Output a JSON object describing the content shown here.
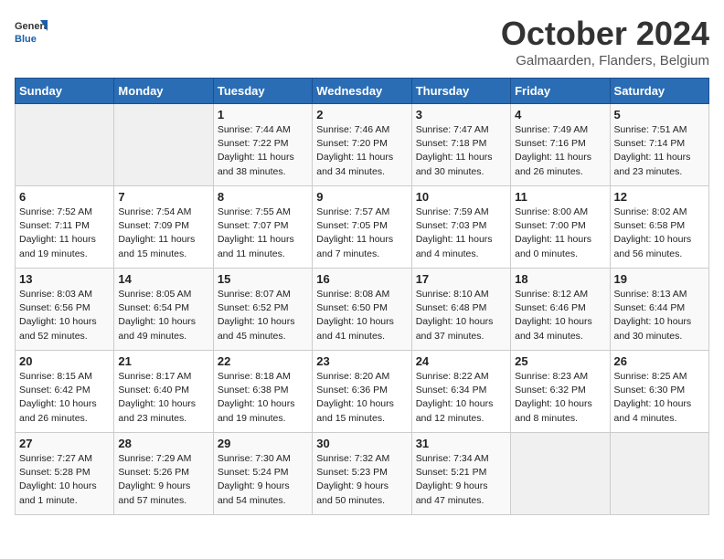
{
  "header": {
    "logo_general": "General",
    "logo_blue": "Blue",
    "title": "October 2024",
    "subtitle": "Galmaarden, Flanders, Belgium"
  },
  "days_of_week": [
    "Sunday",
    "Monday",
    "Tuesday",
    "Wednesday",
    "Thursday",
    "Friday",
    "Saturday"
  ],
  "weeks": [
    [
      {
        "day": "",
        "info": ""
      },
      {
        "day": "",
        "info": ""
      },
      {
        "day": "1",
        "info": "Sunrise: 7:44 AM\nSunset: 7:22 PM\nDaylight: 11 hours\nand 38 minutes."
      },
      {
        "day": "2",
        "info": "Sunrise: 7:46 AM\nSunset: 7:20 PM\nDaylight: 11 hours\nand 34 minutes."
      },
      {
        "day": "3",
        "info": "Sunrise: 7:47 AM\nSunset: 7:18 PM\nDaylight: 11 hours\nand 30 minutes."
      },
      {
        "day": "4",
        "info": "Sunrise: 7:49 AM\nSunset: 7:16 PM\nDaylight: 11 hours\nand 26 minutes."
      },
      {
        "day": "5",
        "info": "Sunrise: 7:51 AM\nSunset: 7:14 PM\nDaylight: 11 hours\nand 23 minutes."
      }
    ],
    [
      {
        "day": "6",
        "info": "Sunrise: 7:52 AM\nSunset: 7:11 PM\nDaylight: 11 hours\nand 19 minutes."
      },
      {
        "day": "7",
        "info": "Sunrise: 7:54 AM\nSunset: 7:09 PM\nDaylight: 11 hours\nand 15 minutes."
      },
      {
        "day": "8",
        "info": "Sunrise: 7:55 AM\nSunset: 7:07 PM\nDaylight: 11 hours\nand 11 minutes."
      },
      {
        "day": "9",
        "info": "Sunrise: 7:57 AM\nSunset: 7:05 PM\nDaylight: 11 hours\nand 7 minutes."
      },
      {
        "day": "10",
        "info": "Sunrise: 7:59 AM\nSunset: 7:03 PM\nDaylight: 11 hours\nand 4 minutes."
      },
      {
        "day": "11",
        "info": "Sunrise: 8:00 AM\nSunset: 7:00 PM\nDaylight: 11 hours\nand 0 minutes."
      },
      {
        "day": "12",
        "info": "Sunrise: 8:02 AM\nSunset: 6:58 PM\nDaylight: 10 hours\nand 56 minutes."
      }
    ],
    [
      {
        "day": "13",
        "info": "Sunrise: 8:03 AM\nSunset: 6:56 PM\nDaylight: 10 hours\nand 52 minutes."
      },
      {
        "day": "14",
        "info": "Sunrise: 8:05 AM\nSunset: 6:54 PM\nDaylight: 10 hours\nand 49 minutes."
      },
      {
        "day": "15",
        "info": "Sunrise: 8:07 AM\nSunset: 6:52 PM\nDaylight: 10 hours\nand 45 minutes."
      },
      {
        "day": "16",
        "info": "Sunrise: 8:08 AM\nSunset: 6:50 PM\nDaylight: 10 hours\nand 41 minutes."
      },
      {
        "day": "17",
        "info": "Sunrise: 8:10 AM\nSunset: 6:48 PM\nDaylight: 10 hours\nand 37 minutes."
      },
      {
        "day": "18",
        "info": "Sunrise: 8:12 AM\nSunset: 6:46 PM\nDaylight: 10 hours\nand 34 minutes."
      },
      {
        "day": "19",
        "info": "Sunrise: 8:13 AM\nSunset: 6:44 PM\nDaylight: 10 hours\nand 30 minutes."
      }
    ],
    [
      {
        "day": "20",
        "info": "Sunrise: 8:15 AM\nSunset: 6:42 PM\nDaylight: 10 hours\nand 26 minutes."
      },
      {
        "day": "21",
        "info": "Sunrise: 8:17 AM\nSunset: 6:40 PM\nDaylight: 10 hours\nand 23 minutes."
      },
      {
        "day": "22",
        "info": "Sunrise: 8:18 AM\nSunset: 6:38 PM\nDaylight: 10 hours\nand 19 minutes."
      },
      {
        "day": "23",
        "info": "Sunrise: 8:20 AM\nSunset: 6:36 PM\nDaylight: 10 hours\nand 15 minutes."
      },
      {
        "day": "24",
        "info": "Sunrise: 8:22 AM\nSunset: 6:34 PM\nDaylight: 10 hours\nand 12 minutes."
      },
      {
        "day": "25",
        "info": "Sunrise: 8:23 AM\nSunset: 6:32 PM\nDaylight: 10 hours\nand 8 minutes."
      },
      {
        "day": "26",
        "info": "Sunrise: 8:25 AM\nSunset: 6:30 PM\nDaylight: 10 hours\nand 4 minutes."
      }
    ],
    [
      {
        "day": "27",
        "info": "Sunrise: 7:27 AM\nSunset: 5:28 PM\nDaylight: 10 hours\nand 1 minute."
      },
      {
        "day": "28",
        "info": "Sunrise: 7:29 AM\nSunset: 5:26 PM\nDaylight: 9 hours\nand 57 minutes."
      },
      {
        "day": "29",
        "info": "Sunrise: 7:30 AM\nSunset: 5:24 PM\nDaylight: 9 hours\nand 54 minutes."
      },
      {
        "day": "30",
        "info": "Sunrise: 7:32 AM\nSunset: 5:23 PM\nDaylight: 9 hours\nand 50 minutes."
      },
      {
        "day": "31",
        "info": "Sunrise: 7:34 AM\nSunset: 5:21 PM\nDaylight: 9 hours\nand 47 minutes."
      },
      {
        "day": "",
        "info": ""
      },
      {
        "day": "",
        "info": ""
      }
    ]
  ]
}
